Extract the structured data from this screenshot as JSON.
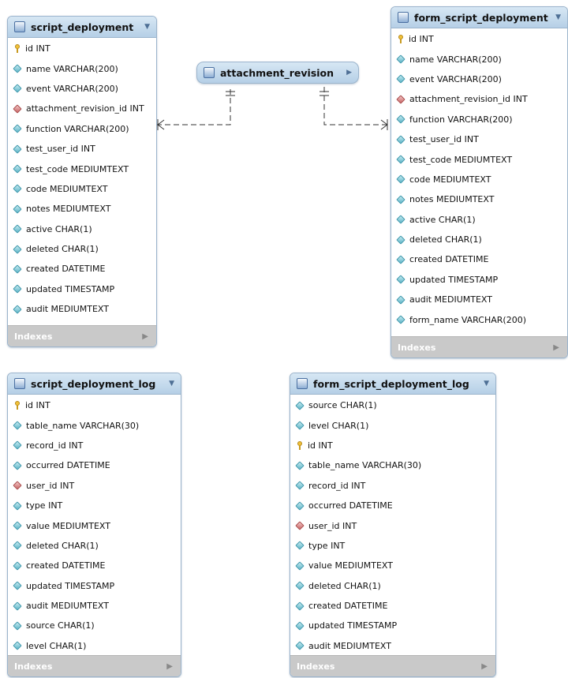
{
  "tables": {
    "script_deployment": {
      "title": "script_deployment",
      "columns": [
        {
          "name": "id INT",
          "kind": "pk"
        },
        {
          "name": "name VARCHAR(200)",
          "kind": "col"
        },
        {
          "name": "event VARCHAR(200)",
          "kind": "col"
        },
        {
          "name": "attachment_revision_id INT",
          "kind": "fk"
        },
        {
          "name": "function VARCHAR(200)",
          "kind": "col"
        },
        {
          "name": "test_user_id INT",
          "kind": "col"
        },
        {
          "name": "test_code MEDIUMTEXT",
          "kind": "col"
        },
        {
          "name": "code MEDIUMTEXT",
          "kind": "col"
        },
        {
          "name": "notes MEDIUMTEXT",
          "kind": "col"
        },
        {
          "name": "active CHAR(1)",
          "kind": "col"
        },
        {
          "name": "deleted CHAR(1)",
          "kind": "col"
        },
        {
          "name": "created DATETIME",
          "kind": "col"
        },
        {
          "name": "updated TIMESTAMP",
          "kind": "col"
        },
        {
          "name": "audit MEDIUMTEXT",
          "kind": "col"
        }
      ],
      "footer": "Indexes"
    },
    "form_script_deployment": {
      "title": "form_script_deployment",
      "columns": [
        {
          "name": "id INT",
          "kind": "pk"
        },
        {
          "name": "name VARCHAR(200)",
          "kind": "col"
        },
        {
          "name": "event VARCHAR(200)",
          "kind": "col"
        },
        {
          "name": "attachment_revision_id INT",
          "kind": "fk"
        },
        {
          "name": "function VARCHAR(200)",
          "kind": "col"
        },
        {
          "name": "test_user_id INT",
          "kind": "col"
        },
        {
          "name": "test_code MEDIUMTEXT",
          "kind": "col"
        },
        {
          "name": "code MEDIUMTEXT",
          "kind": "col"
        },
        {
          "name": "notes MEDIUMTEXT",
          "kind": "col"
        },
        {
          "name": "active CHAR(1)",
          "kind": "col"
        },
        {
          "name": "deleted CHAR(1)",
          "kind": "col"
        },
        {
          "name": "created DATETIME",
          "kind": "col"
        },
        {
          "name": "updated TIMESTAMP",
          "kind": "col"
        },
        {
          "name": "audit MEDIUMTEXT",
          "kind": "col"
        },
        {
          "name": "form_name VARCHAR(200)",
          "kind": "col"
        }
      ],
      "footer": "Indexes"
    },
    "script_deployment_log": {
      "title": "script_deployment_log",
      "columns": [
        {
          "name": "id INT",
          "kind": "pk"
        },
        {
          "name": "table_name VARCHAR(30)",
          "kind": "col"
        },
        {
          "name": "record_id INT",
          "kind": "col"
        },
        {
          "name": "occurred DATETIME",
          "kind": "col"
        },
        {
          "name": "user_id INT",
          "kind": "fk"
        },
        {
          "name": "type INT",
          "kind": "col"
        },
        {
          "name": "value MEDIUMTEXT",
          "kind": "col"
        },
        {
          "name": "deleted CHAR(1)",
          "kind": "col"
        },
        {
          "name": "created DATETIME",
          "kind": "col"
        },
        {
          "name": "updated TIMESTAMP",
          "kind": "col"
        },
        {
          "name": "audit MEDIUMTEXT",
          "kind": "col"
        },
        {
          "name": "source CHAR(1)",
          "kind": "col"
        },
        {
          "name": "level CHAR(1)",
          "kind": "col"
        }
      ],
      "footer": "Indexes"
    },
    "form_script_deployment_log": {
      "title": "form_script_deployment_log",
      "columns": [
        {
          "name": "source CHAR(1)",
          "kind": "col"
        },
        {
          "name": "level CHAR(1)",
          "kind": "col"
        },
        {
          "name": "id INT",
          "kind": "pk"
        },
        {
          "name": "table_name VARCHAR(30)",
          "kind": "col"
        },
        {
          "name": "record_id INT",
          "kind": "col"
        },
        {
          "name": "occurred DATETIME",
          "kind": "col"
        },
        {
          "name": "user_id INT",
          "kind": "fk"
        },
        {
          "name": "type INT",
          "kind": "col"
        },
        {
          "name": "value MEDIUMTEXT",
          "kind": "col"
        },
        {
          "name": "deleted CHAR(1)",
          "kind": "col"
        },
        {
          "name": "created DATETIME",
          "kind": "col"
        },
        {
          "name": "updated TIMESTAMP",
          "kind": "col"
        },
        {
          "name": "audit MEDIUMTEXT",
          "kind": "col"
        }
      ],
      "footer": "Indexes"
    }
  },
  "attachment_revision": {
    "title": "attachment_revision"
  },
  "relationships": [
    {
      "from": "script_deployment",
      "to": "attachment_revision"
    },
    {
      "from": "form_script_deployment",
      "to": "attachment_revision"
    }
  ],
  "colors": {
    "header": "#b5cfe6",
    "border": "#9bb4cc",
    "footer": "#c9c9c9",
    "line": "#333333"
  }
}
